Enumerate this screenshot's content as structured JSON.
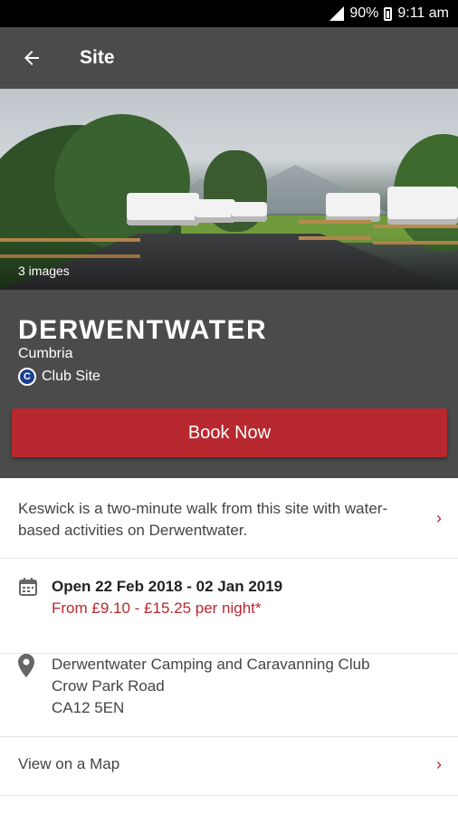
{
  "status_bar": {
    "battery": "90%",
    "time": "9:11 am"
  },
  "app_bar": {
    "title": "Site"
  },
  "hero": {
    "image_count": "3 images"
  },
  "site": {
    "name": "DERWENTWATER",
    "region": "Cumbria",
    "club_badge_letter": "C",
    "club_label": "Club Site",
    "book_label": "Book Now"
  },
  "description": "Keswick is a two-minute walk from this site with water-based activities on Derwentwater.",
  "dates": {
    "open": "Open 22 Feb 2018 - 02 Jan 2019",
    "price": "From £9.10 - £15.25 per night*"
  },
  "address": {
    "line1": "Derwentwater Camping and Caravanning Club",
    "line2": "Crow Park Road",
    "line3": "CA12 5EN"
  },
  "map_link": "View on a Map",
  "colors": {
    "accent": "#b8282f",
    "header": "#4b4b4b",
    "club_badge": "#1d3f8f"
  }
}
